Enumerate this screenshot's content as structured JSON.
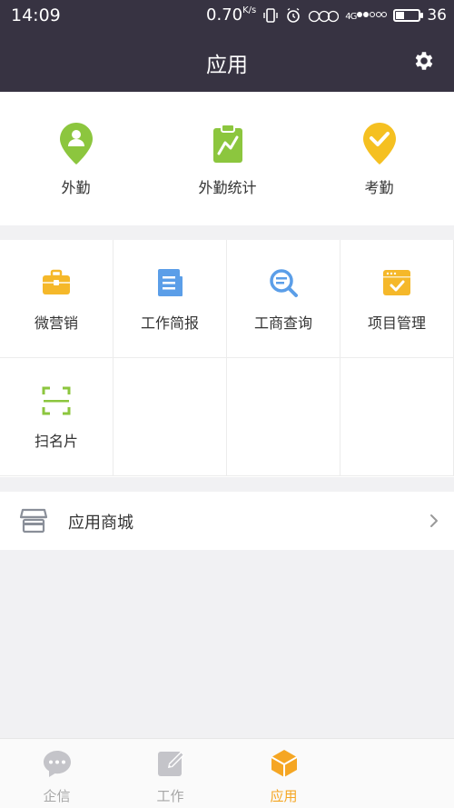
{
  "status_bar": {
    "time": "14:09",
    "speed": "0.70",
    "speed_unit": "K/s",
    "network": "4G",
    "battery": "36",
    "battery_level": 0.36
  },
  "header": {
    "title": "应用",
    "settings_icon": "gear-icon"
  },
  "quick_actions": [
    {
      "label": "外勤",
      "icon": "location-person-icon",
      "color": "#8cc63e"
    },
    {
      "label": "外勤统计",
      "icon": "stats-clipboard-icon",
      "color": "#8cc63e"
    },
    {
      "label": "考勤",
      "icon": "location-check-icon",
      "color": "#f5c021"
    }
  ],
  "apps": [
    {
      "label": "微营销",
      "icon": "briefcase-icon",
      "color": "#f5b82a"
    },
    {
      "label": "工作简报",
      "icon": "newspaper-icon",
      "color": "#5b9ee8"
    },
    {
      "label": "工商查询",
      "icon": "search-doc-icon",
      "color": "#5b9ee8"
    },
    {
      "label": "项目管理",
      "icon": "window-check-icon",
      "color": "#f5b82a"
    },
    {
      "label": "扫名片",
      "icon": "scan-icon",
      "color": "#8cc63e"
    }
  ],
  "store": {
    "label": "应用商城",
    "icon": "store-icon"
  },
  "tabs": [
    {
      "label": "企信",
      "icon": "chat-icon",
      "active": false
    },
    {
      "label": "工作",
      "icon": "edit-icon",
      "active": false
    },
    {
      "label": "应用",
      "icon": "cube-icon",
      "active": true
    }
  ],
  "colors": {
    "header_bg": "#373342",
    "active_tab": "#f5a623",
    "inactive_tab": "#a6a6a6",
    "page_bg": "#f1f1f3"
  }
}
